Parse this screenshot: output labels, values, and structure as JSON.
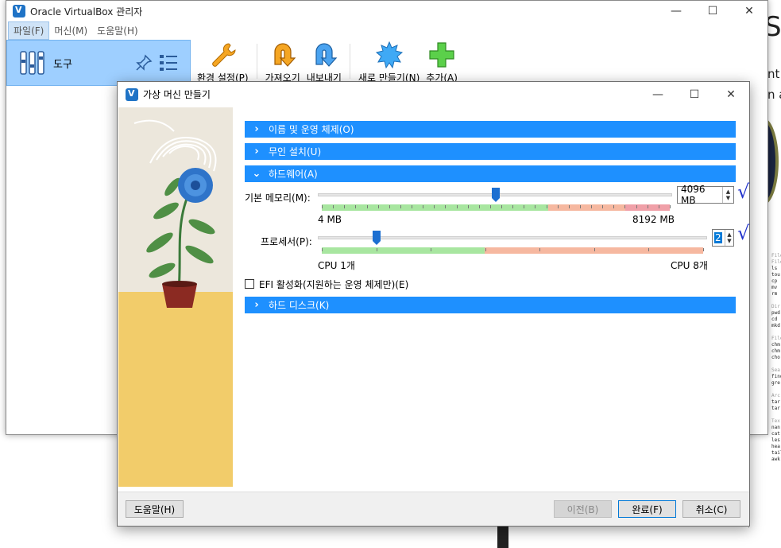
{
  "background": {
    "side_letter": "S",
    "side_text": [
      "nt",
      "n a"
    ],
    "panel_lines": [
      {
        "t": "File",
        "h": true
      },
      {
        "t": "File",
        "h": true
      },
      {
        "t": "ls"
      },
      {
        "t": "tou"
      },
      {
        "t": "cp"
      },
      {
        "t": "mv"
      },
      {
        "t": "rm"
      },
      {
        "t": ""
      },
      {
        "t": "Dir",
        "h": true
      },
      {
        "t": "pwd"
      },
      {
        "t": "cd"
      },
      {
        "t": "mkd"
      },
      {
        "t": ""
      },
      {
        "t": "File",
        "h": true
      },
      {
        "t": "chm"
      },
      {
        "t": "chm"
      },
      {
        "t": "cho"
      },
      {
        "t": ""
      },
      {
        "t": "Sea",
        "h": true
      },
      {
        "t": "find"
      },
      {
        "t": "gre"
      },
      {
        "t": ""
      },
      {
        "t": "Arc",
        "h": true
      },
      {
        "t": "tar"
      },
      {
        "t": "tar"
      },
      {
        "t": ""
      },
      {
        "t": "Tex",
        "h": true
      },
      {
        "t": "nan"
      },
      {
        "t": "cat"
      },
      {
        "t": "les"
      },
      {
        "t": "hea"
      },
      {
        "t": "tail"
      },
      {
        "t": "awk"
      }
    ]
  },
  "manager": {
    "title": "Oracle VirtualBox 관리자",
    "menu": [
      "파일(F)",
      "머신(M)",
      "도움말(H)"
    ],
    "sidebar": {
      "label": "도구"
    },
    "toolbar": [
      {
        "label": "환경 설정(P)",
        "icon": "wrench-icon"
      },
      {
        "label": "가져오기",
        "icon": "import-icon"
      },
      {
        "label": "내보내기",
        "icon": "export-icon"
      },
      {
        "label": "새로 만들기(N)",
        "icon": "new-vm-icon"
      },
      {
        "label": "추가(A)",
        "icon": "add-icon"
      }
    ]
  },
  "dialog": {
    "title": "가상 머신 만들기",
    "sections": {
      "name_os": "이름 및 운영 체제(O)",
      "unattended": "무인 설치(U)",
      "hardware": "하드웨어(A)",
      "hard_disk": "하드 디스크(K)"
    },
    "memory": {
      "label": "기본 메모리(M):",
      "value_text": "4096 MB",
      "value_mb": 4096,
      "min_label": "4 MB",
      "max_label": "8192 MB"
    },
    "processor": {
      "label": "프로세서(P):",
      "value_text": "2",
      "value": 2,
      "min_label": "CPU 1개",
      "max_label": "CPU 8개"
    },
    "efi": {
      "label": "EFI 활성화(지원하는 운영 체제만)(E)",
      "checked": false
    },
    "buttons": {
      "help": "도움말(H)",
      "back": "이전(B)",
      "finish": "완료(F)",
      "cancel": "취소(C)"
    },
    "annotations": [
      "√",
      "√"
    ],
    "colors": {
      "section_bar": "#1e90ff",
      "illus_floor": "#f2cc6a"
    }
  }
}
